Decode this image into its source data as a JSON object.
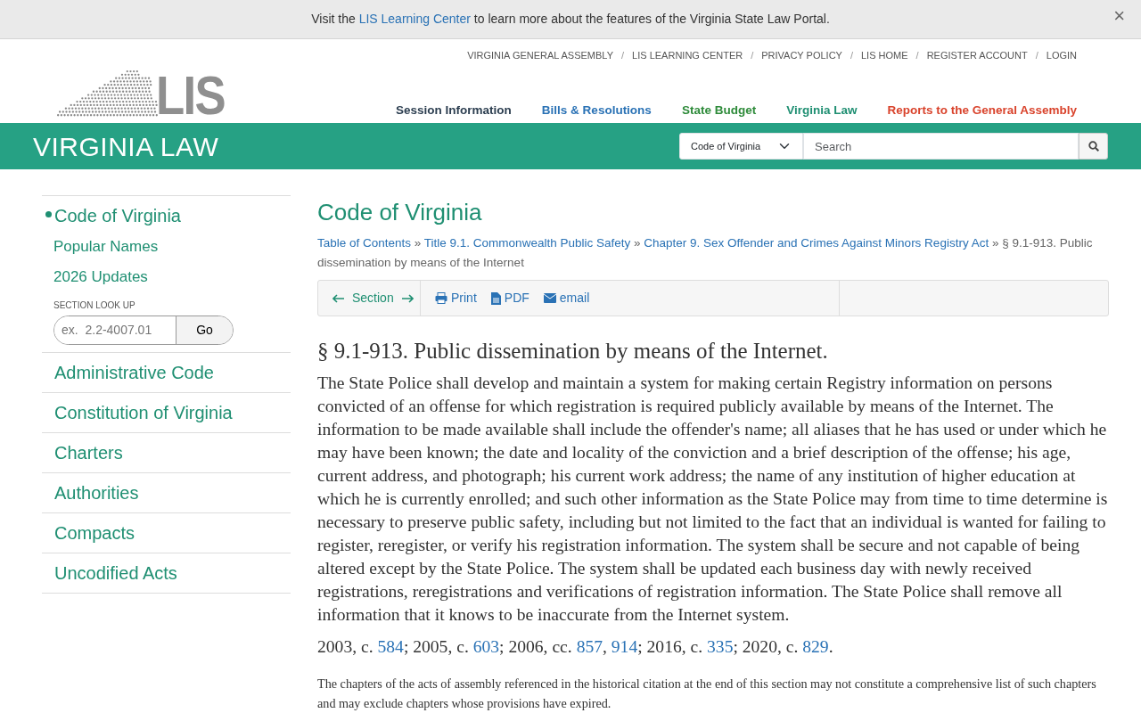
{
  "alert": {
    "segments": [
      {
        "kind": "text",
        "text": "Visit the "
      },
      {
        "kind": "link",
        "text": "LIS Learning Center"
      },
      {
        "kind": "text",
        "text": " to learn more about the features of the Virginia State Law Portal."
      }
    ],
    "close": "×"
  },
  "logo": {
    "text": "LIS"
  },
  "top_links": {
    "separator": "/",
    "items": [
      "VIRGINIA GENERAL ASSEMBLY",
      "LIS LEARNING CENTER",
      "PRIVACY POLICY",
      "LIS HOME",
      "REGISTER ACCOUNT",
      "LOGIN"
    ]
  },
  "main_nav": [
    {
      "label": "Session Information",
      "color": "#2c3e50"
    },
    {
      "label": "Bills & Resolutions",
      "color": "#2a72b5"
    },
    {
      "label": "State Budget",
      "color": "#2e8b3a"
    },
    {
      "label": "Virginia Law",
      "color": "#1f8f72"
    },
    {
      "label": "Reports to the General Assembly",
      "color": "#d9432c"
    }
  ],
  "banner": {
    "title": "VIRGINIA LAW",
    "scope": "Code of Virginia",
    "search_placeholder": "Search"
  },
  "sidebar": {
    "items": [
      {
        "label": "Code of Virginia",
        "selected": true,
        "children": [
          {
            "label": "Popular Names"
          },
          {
            "label": "2026 Updates"
          }
        ]
      },
      {
        "label": "Administrative Code",
        "selected": false
      },
      {
        "label": "Constitution of Virginia",
        "selected": false
      },
      {
        "label": "Charters",
        "selected": false
      },
      {
        "label": "Authorities",
        "selected": false
      },
      {
        "label": "Compacts",
        "selected": false
      },
      {
        "label": "Uncodified Acts",
        "selected": false
      }
    ],
    "lookup": {
      "label": "SECTION LOOK UP",
      "placeholder": "ex.  2.2-4007.01",
      "button": "Go"
    }
  },
  "page_title": "Code of Virginia",
  "breadcrumb": {
    "separator": "»",
    "items": [
      {
        "text": "Table of Contents",
        "link": true
      },
      {
        "text": "Title 9.1. Commonwealth Public Safety",
        "link": true
      },
      {
        "text": "Chapter 9. Sex Offender and Crimes Against Minors Registry Act",
        "link": true
      },
      {
        "text": "§ 9.1-913. Public dissemination by means of the Internet",
        "link": false
      }
    ]
  },
  "toolbar": {
    "section": "Section",
    "actions": [
      {
        "kind": "print",
        "label": "Print"
      },
      {
        "kind": "pdf",
        "label": "PDF"
      },
      {
        "kind": "email",
        "label": "email"
      }
    ]
  },
  "section_title": "§ 9.1-913. Public dissemination by means of the Internet.",
  "body": "The State Police shall develop and maintain a system for making certain Registry information on persons convicted of an offense for which registration is required publicly available by means of the Internet. The information to be made available shall include the offender's name; all aliases that he has used or under which he may have been known; the date and locality of the conviction and a brief description of the offense; his age, current address, and photograph; his current work address; the name of any institution of higher education at which he is currently enrolled; and such other information as the State Police may from time to time determine is necessary to preserve public safety, including but not limited to the fact that an individual is wanted for failing to register, reregister, or verify his registration information. The system shall be secure and not capable of being altered except by the State Police. The system shall be updated each business day with newly received registrations, reregistrations and verifications of registration information. The State Police shall remove all information that it knows to be inaccurate from the Internet system.",
  "history": [
    {
      "kind": "text",
      "text": "2003, c. "
    },
    {
      "kind": "link",
      "text": "584"
    },
    {
      "kind": "text",
      "text": "; 2005, c. "
    },
    {
      "kind": "link",
      "text": "603"
    },
    {
      "kind": "text",
      "text": "; 2006, cc. "
    },
    {
      "kind": "link",
      "text": "857"
    },
    {
      "kind": "text",
      "text": ", "
    },
    {
      "kind": "link",
      "text": "914"
    },
    {
      "kind": "text",
      "text": "; 2016, c. "
    },
    {
      "kind": "link",
      "text": "335"
    },
    {
      "kind": "text",
      "text": "; 2020, c. "
    },
    {
      "kind": "link",
      "text": "829"
    },
    {
      "kind": "text",
      "text": "."
    }
  ],
  "note": "The chapters of the acts of assembly referenced in the historical citation at the end of this section may not constitute a comprehensive list of such chapters and may exclude chapters whose provisions have expired."
}
